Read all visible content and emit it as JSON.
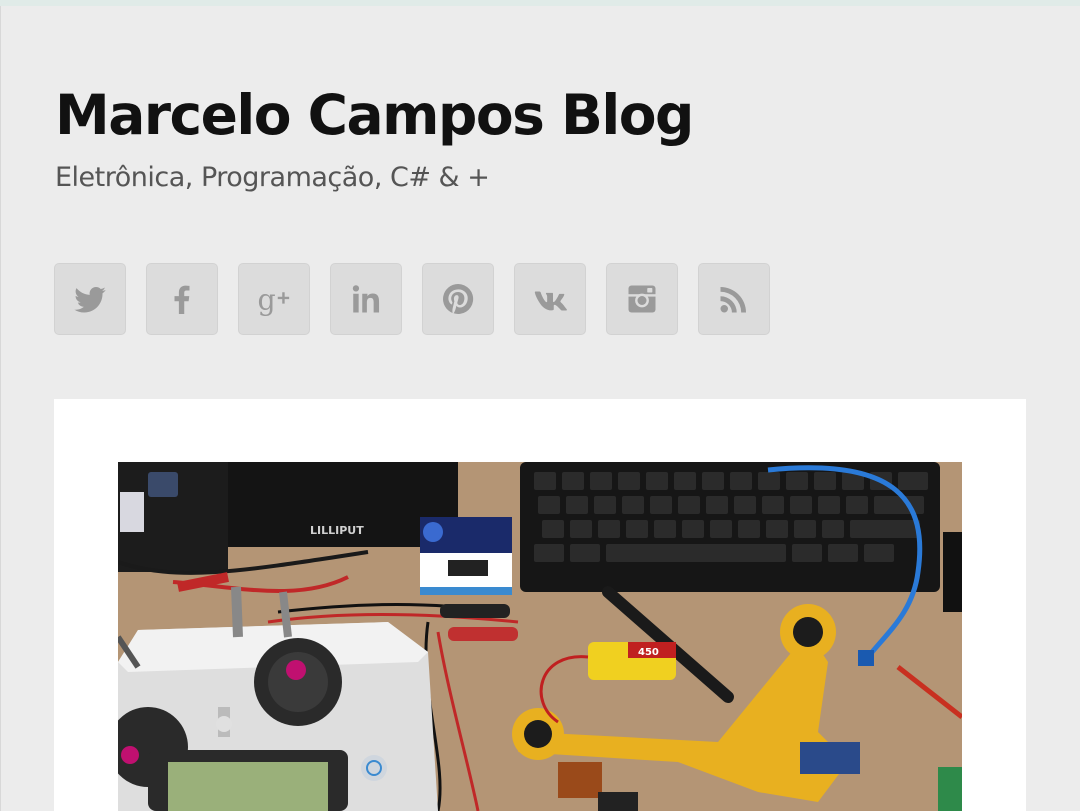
{
  "site": {
    "title": "Marcelo Campos Blog",
    "description": "Eletrônica, Programação, C# & +"
  },
  "social": [
    {
      "name": "twitter",
      "icon": "twitter-icon"
    },
    {
      "name": "facebook",
      "icon": "facebook-icon"
    },
    {
      "name": "google-plus",
      "icon": "google-plus-icon"
    },
    {
      "name": "linkedin",
      "icon": "linkedin-icon"
    },
    {
      "name": "pinterest",
      "icon": "pinterest-icon"
    },
    {
      "name": "vk",
      "icon": "vk-icon"
    },
    {
      "name": "instagram",
      "icon": "instagram-icon"
    },
    {
      "name": "rss",
      "icon": "rss-icon"
    }
  ],
  "photo": {
    "monitor_label": "LILLIPUT",
    "battery_label": "450"
  },
  "colors": {
    "background": "#ececec",
    "icon": "#9a9a9a",
    "icon_bg": "#dcdcdc",
    "title": "#111111",
    "description": "#555555"
  }
}
